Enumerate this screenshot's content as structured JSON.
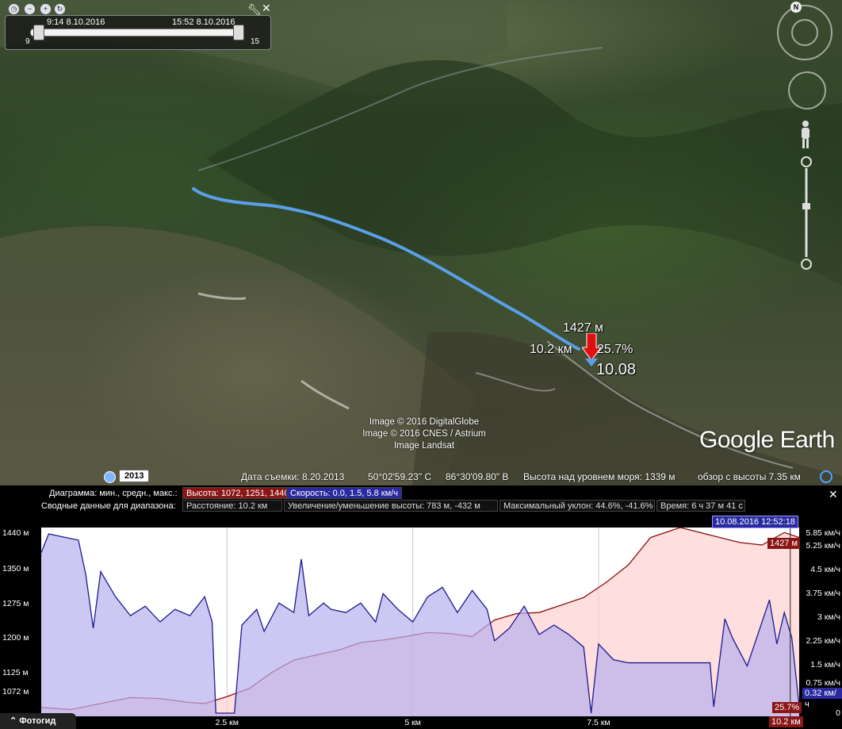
{
  "time_slider": {
    "start_time": "9:14 8.10.2016",
    "end_time": "15:52 8.10.2016",
    "range_min": "9",
    "range_max": "15"
  },
  "map_labels": {
    "elevation": "1427 м",
    "distance": "10.2 км",
    "grade": "25.7%",
    "position_km": "10.08"
  },
  "attribution": {
    "line1": "Image © 2016 DigitalGlobe",
    "line2": "Image © 2016 CNES / Astrium",
    "line3": "Image Landsat"
  },
  "logo": "Google Earth",
  "status_bar": {
    "year": "2013",
    "imagery_date": "Дата съемки: 8.20.2013",
    "latitude": "50°02'59.23\" С",
    "longitude": "86°30'09.80\" В",
    "altitude": "Высота над уровнем моря:  1339 м",
    "eye_alt": "обзор с высоты    7.35 км"
  },
  "profile": {
    "legend_label_1": "Диаграмма: мин., средн., макс.:",
    "legend_elevation": "Высота: 1072, 1251, 1440 м",
    "legend_speed": "Скорость: 0.0, 1.5, 5.8 км/ч",
    "legend_label_2": "Сводные данные для диапазона:",
    "summary_distance": "Расстояние: 10.2 км",
    "summary_gain": "Увеличение/уменьшение высоты: 783 м, -432 м",
    "summary_slope": "Максимальный уклон: 44.6%, -41.6%",
    "summary_time": "Время: 6 ч 37 м 41 с",
    "cursor_date": "10.08.2016 12:52:18",
    "cursor_elev": "1427 м",
    "cursor_speed": "0.32 км/ч",
    "cursor_grade": "25.7%",
    "cursor_dist": "10.2 км",
    "tour_guide": "Фотогид"
  },
  "colors": {
    "elevation_line": "#8a1010",
    "elevation_fill": "#ffd0d0",
    "speed_line": "#1a1a90",
    "speed_fill": "#b8b0ee",
    "track": "#5aa0e8"
  },
  "chart_data": {
    "type": "area",
    "x_unit": "км",
    "xlim": [
      0,
      10.2
    ],
    "x_ticks": [
      "2.5 км",
      "5 км",
      "7.5 км"
    ],
    "y_left_ticks": [
      "1440 м",
      "1350 м",
      "1275 м",
      "1200 м",
      "1125 м",
      "1072 м"
    ],
    "y_left_lim": [
      1072,
      1440
    ],
    "y_right_ticks": [
      "5.85 км/ч",
      "5.25 км/ч",
      "4.5 км/ч",
      "3.75 км/ч",
      "3 км/ч",
      "2.25 км/ч",
      "1.5 км/ч",
      "0.75 км/ч",
      "0"
    ],
    "y_right_lim": [
      0,
      5.85
    ],
    "series": [
      {
        "name": "Высота",
        "axis": "left",
        "points": [
          [
            0,
            1080
          ],
          [
            0.4,
            1076
          ],
          [
            0.8,
            1088
          ],
          [
            1.2,
            1100
          ],
          [
            1.6,
            1098
          ],
          [
            2.0,
            1090
          ],
          [
            2.2,
            1088
          ],
          [
            2.5,
            1102
          ],
          [
            2.8,
            1118
          ],
          [
            3.1,
            1150
          ],
          [
            3.4,
            1175
          ],
          [
            3.7,
            1185
          ],
          [
            4.0,
            1195
          ],
          [
            4.3,
            1210
          ],
          [
            4.6,
            1215
          ],
          [
            4.9,
            1222
          ],
          [
            5.2,
            1230
          ],
          [
            5.5,
            1228
          ],
          [
            5.8,
            1222
          ],
          [
            6.1,
            1255
          ],
          [
            6.4,
            1268
          ],
          [
            6.7,
            1270
          ],
          [
            7.0,
            1285
          ],
          [
            7.3,
            1300
          ],
          [
            7.6,
            1330
          ],
          [
            7.9,
            1365
          ],
          [
            8.2,
            1420
          ],
          [
            8.6,
            1440
          ],
          [
            9.0,
            1425
          ],
          [
            9.4,
            1410
          ],
          [
            9.7,
            1405
          ],
          [
            10.0,
            1430
          ],
          [
            10.2,
            1420
          ]
        ]
      },
      {
        "name": "Скорость",
        "axis": "right",
        "points": [
          [
            0,
            5.2
          ],
          [
            0.1,
            5.8
          ],
          [
            0.3,
            5.7
          ],
          [
            0.5,
            5.6
          ],
          [
            0.6,
            4.5
          ],
          [
            0.7,
            2.8
          ],
          [
            0.8,
            4.6
          ],
          [
            1.0,
            3.8
          ],
          [
            1.2,
            3.2
          ],
          [
            1.4,
            3.5
          ],
          [
            1.6,
            3.0
          ],
          [
            1.8,
            3.4
          ],
          [
            2.0,
            3.2
          ],
          [
            2.2,
            3.8
          ],
          [
            2.3,
            3.0
          ],
          [
            2.35,
            0.1
          ],
          [
            2.5,
            0.1
          ],
          [
            2.6,
            0.1
          ],
          [
            2.7,
            2.9
          ],
          [
            2.9,
            3.4
          ],
          [
            3.0,
            2.7
          ],
          [
            3.2,
            3.6
          ],
          [
            3.4,
            3.3
          ],
          [
            3.5,
            5.0
          ],
          [
            3.6,
            3.2
          ],
          [
            3.8,
            3.6
          ],
          [
            3.9,
            3.4
          ],
          [
            4.1,
            3.3
          ],
          [
            4.3,
            3.6
          ],
          [
            4.5,
            3.0
          ],
          [
            4.6,
            3.9
          ],
          [
            4.8,
            3.4
          ],
          [
            5.0,
            3.0
          ],
          [
            5.2,
            3.8
          ],
          [
            5.4,
            4.1
          ],
          [
            5.6,
            3.3
          ],
          [
            5.8,
            4.0
          ],
          [
            6.0,
            3.4
          ],
          [
            6.1,
            2.4
          ],
          [
            6.3,
            2.8
          ],
          [
            6.5,
            3.5
          ],
          [
            6.7,
            2.6
          ],
          [
            6.9,
            2.9
          ],
          [
            7.1,
            2.6
          ],
          [
            7.3,
            2.2
          ],
          [
            7.4,
            0.1
          ],
          [
            7.5,
            2.3
          ],
          [
            7.7,
            1.8
          ],
          [
            7.9,
            1.7
          ],
          [
            8.3,
            1.7
          ],
          [
            8.8,
            1.7
          ],
          [
            9.0,
            1.7
          ],
          [
            9.05,
            0.3
          ],
          [
            9.2,
            3.1
          ],
          [
            9.3,
            2.5
          ],
          [
            9.5,
            1.6
          ],
          [
            9.7,
            3.0
          ],
          [
            9.8,
            3.7
          ],
          [
            9.9,
            2.3
          ],
          [
            10.0,
            3.3
          ],
          [
            10.1,
            2.5
          ],
          [
            10.2,
            0.32
          ]
        ]
      }
    ],
    "cursor_x": 10.08
  }
}
